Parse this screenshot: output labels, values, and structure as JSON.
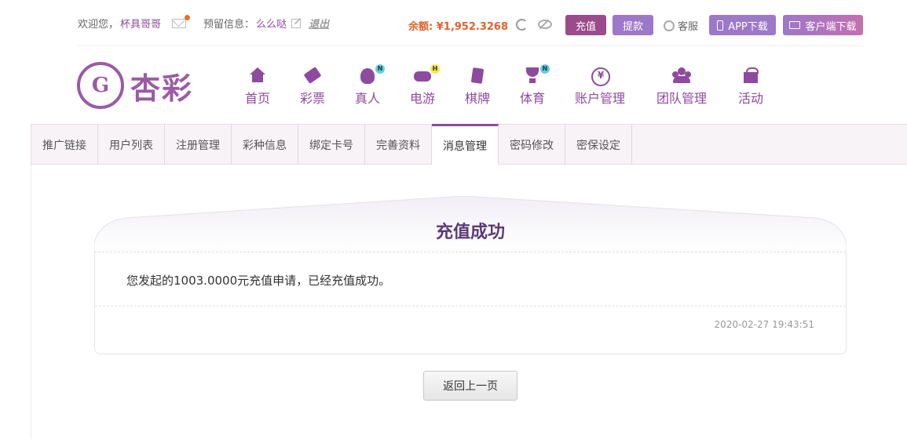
{
  "topbar": {
    "welcome_prefix": "欢迎您，",
    "username": "杯具哥哥",
    "reserve_label": "预留信息：",
    "reserve_value": "么么哒",
    "logout": "退出",
    "balance_label": "余额:",
    "balance_value": "¥1,952.3268",
    "recharge": "充值",
    "withdraw": "提款",
    "service": "客服",
    "app_download": "APP下载",
    "client_download": "客户端下载"
  },
  "logo": {
    "mark": "G",
    "text": "杏彩"
  },
  "nav": [
    {
      "label": "首页",
      "icon": "home-icon"
    },
    {
      "label": "彩票",
      "icon": "ticket-icon"
    },
    {
      "label": "真人",
      "icon": "live-dealer-icon",
      "badge": "N"
    },
    {
      "label": "电游",
      "icon": "gamepad-icon",
      "badge": "H"
    },
    {
      "label": "棋牌",
      "icon": "cards-icon"
    },
    {
      "label": "体育",
      "icon": "trophy-icon",
      "badge": "N"
    },
    {
      "label": "账户管理",
      "icon": "yuan-coin-icon"
    },
    {
      "label": "团队管理",
      "icon": "team-icon"
    },
    {
      "label": "活动",
      "icon": "gift-icon"
    }
  ],
  "tabs": [
    "推广链接",
    "用户列表",
    "注册管理",
    "彩种信息",
    "绑定卡号",
    "完善资料",
    "消息管理",
    "密码修改",
    "密保设定"
  ],
  "active_tab": "消息管理",
  "message": {
    "title": "充值成功",
    "body": "您发起的1003.0000元充值申请，已经充值成功。",
    "timestamp": "2020-02-27 19:43:51"
  },
  "back_button": "返回上一页",
  "colors": {
    "brand": "#8e4a9e",
    "balance": "#e2612b",
    "title": "#5b3a7a"
  }
}
